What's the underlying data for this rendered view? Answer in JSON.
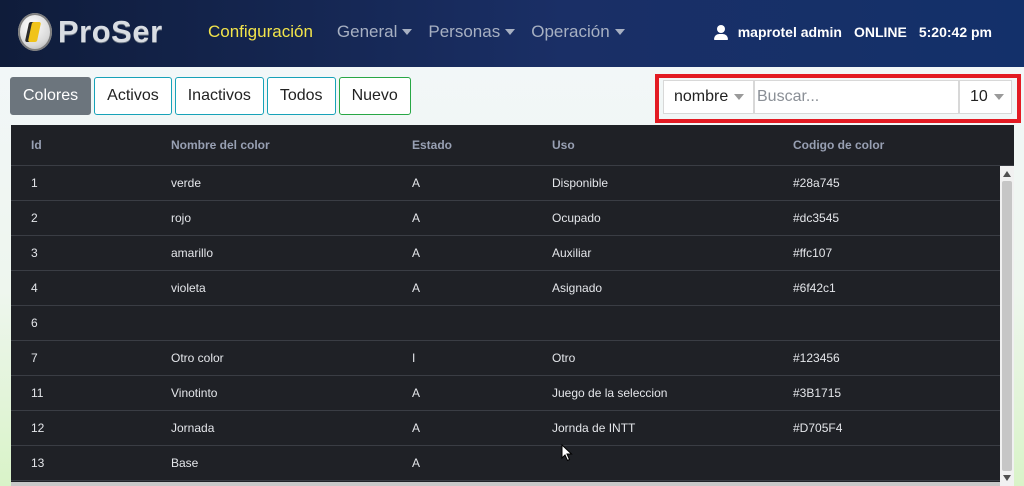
{
  "brand": {
    "name": "ProSer"
  },
  "nav": {
    "items": [
      {
        "label": "Configuración",
        "active": true,
        "dropdown": false
      },
      {
        "label": "General",
        "active": false,
        "dropdown": true
      },
      {
        "label": "Personas",
        "active": false,
        "dropdown": true
      },
      {
        "label": "Operación",
        "active": false,
        "dropdown": true
      }
    ],
    "user": "maprotel admin",
    "status": "ONLINE",
    "time": "5:20:42 pm"
  },
  "toolbar": {
    "buttons": [
      {
        "label": "Colores",
        "style": "selected"
      },
      {
        "label": "Activos",
        "style": "info"
      },
      {
        "label": "Inactivos",
        "style": "info"
      },
      {
        "label": "Todos",
        "style": "info"
      },
      {
        "label": "Nuevo",
        "style": "success"
      }
    ]
  },
  "search": {
    "field": "nombre",
    "placeholder": "Buscar...",
    "page_size": "10"
  },
  "table": {
    "columns": [
      "Id",
      "Nombre del color",
      "Estado",
      "Uso",
      "Codigo de color"
    ],
    "rows": [
      [
        "1",
        "verde",
        "A",
        "Disponible",
        "#28a745"
      ],
      [
        "2",
        "rojo",
        "A",
        "Ocupado",
        "#dc3545"
      ],
      [
        "3",
        "amarillo",
        "A",
        "Auxiliar",
        "#ffc107"
      ],
      [
        "4",
        "violeta",
        "A",
        "Asignado",
        "#6f42c1"
      ],
      [
        "6",
        "",
        "",
        "",
        ""
      ],
      [
        "7",
        "Otro color",
        "I",
        "Otro",
        "#123456"
      ],
      [
        "11",
        "Vinotinto",
        "A",
        "Juego de la seleccion",
        "#3B1715"
      ],
      [
        "12",
        "Jornada",
        "A",
        "Jornda de INTT",
        "#D705F4"
      ],
      [
        "13",
        "Base",
        "A",
        "",
        ""
      ]
    ]
  },
  "colors": {
    "active_nav": "#f2e44a",
    "highlight_border": "#e31b23",
    "table_bg": "#1f2126"
  }
}
